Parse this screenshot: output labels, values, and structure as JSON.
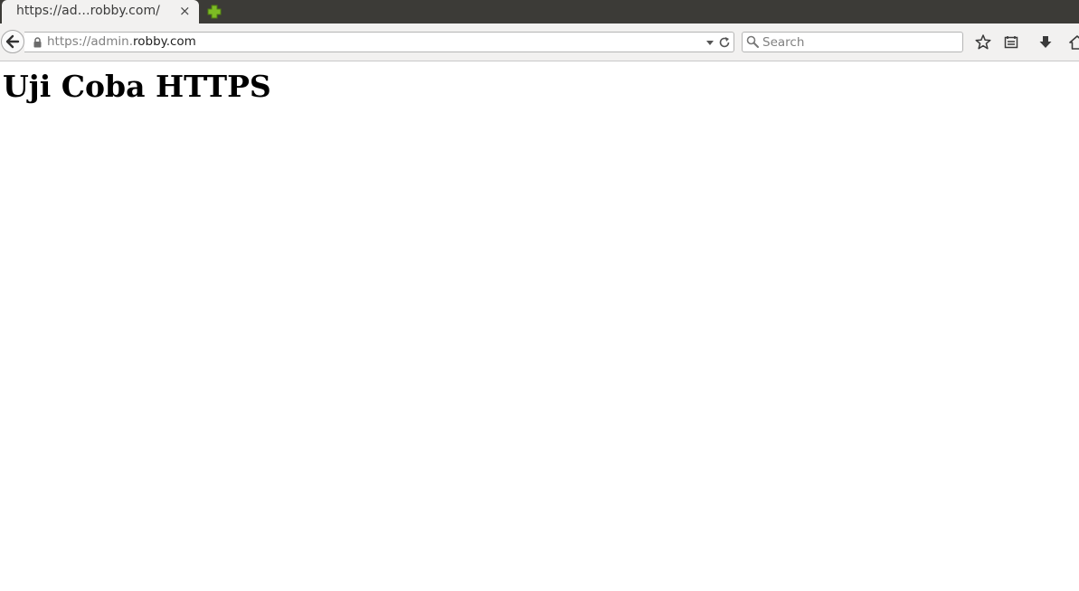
{
  "browser": {
    "tab": {
      "title": "https://ad…robby.com/",
      "close_glyph": "×"
    },
    "new_tab_icon": "plus-icon",
    "url_bar": {
      "prefix": "https://admin.",
      "domain": "robby.com",
      "secure_icon": "lock-icon"
    },
    "search": {
      "placeholder": "Search",
      "value": ""
    },
    "toolbar_icons": [
      "bookmark-star-icon",
      "reading-list-icon",
      "download-icon",
      "home-icon"
    ],
    "colors": {
      "tabbar_bg": "#3c3b37",
      "toolbar_bg": "#f2f1f0",
      "new_tab_green": "#7dbb24"
    }
  },
  "page": {
    "heading": "Uji Coba HTTPS"
  }
}
